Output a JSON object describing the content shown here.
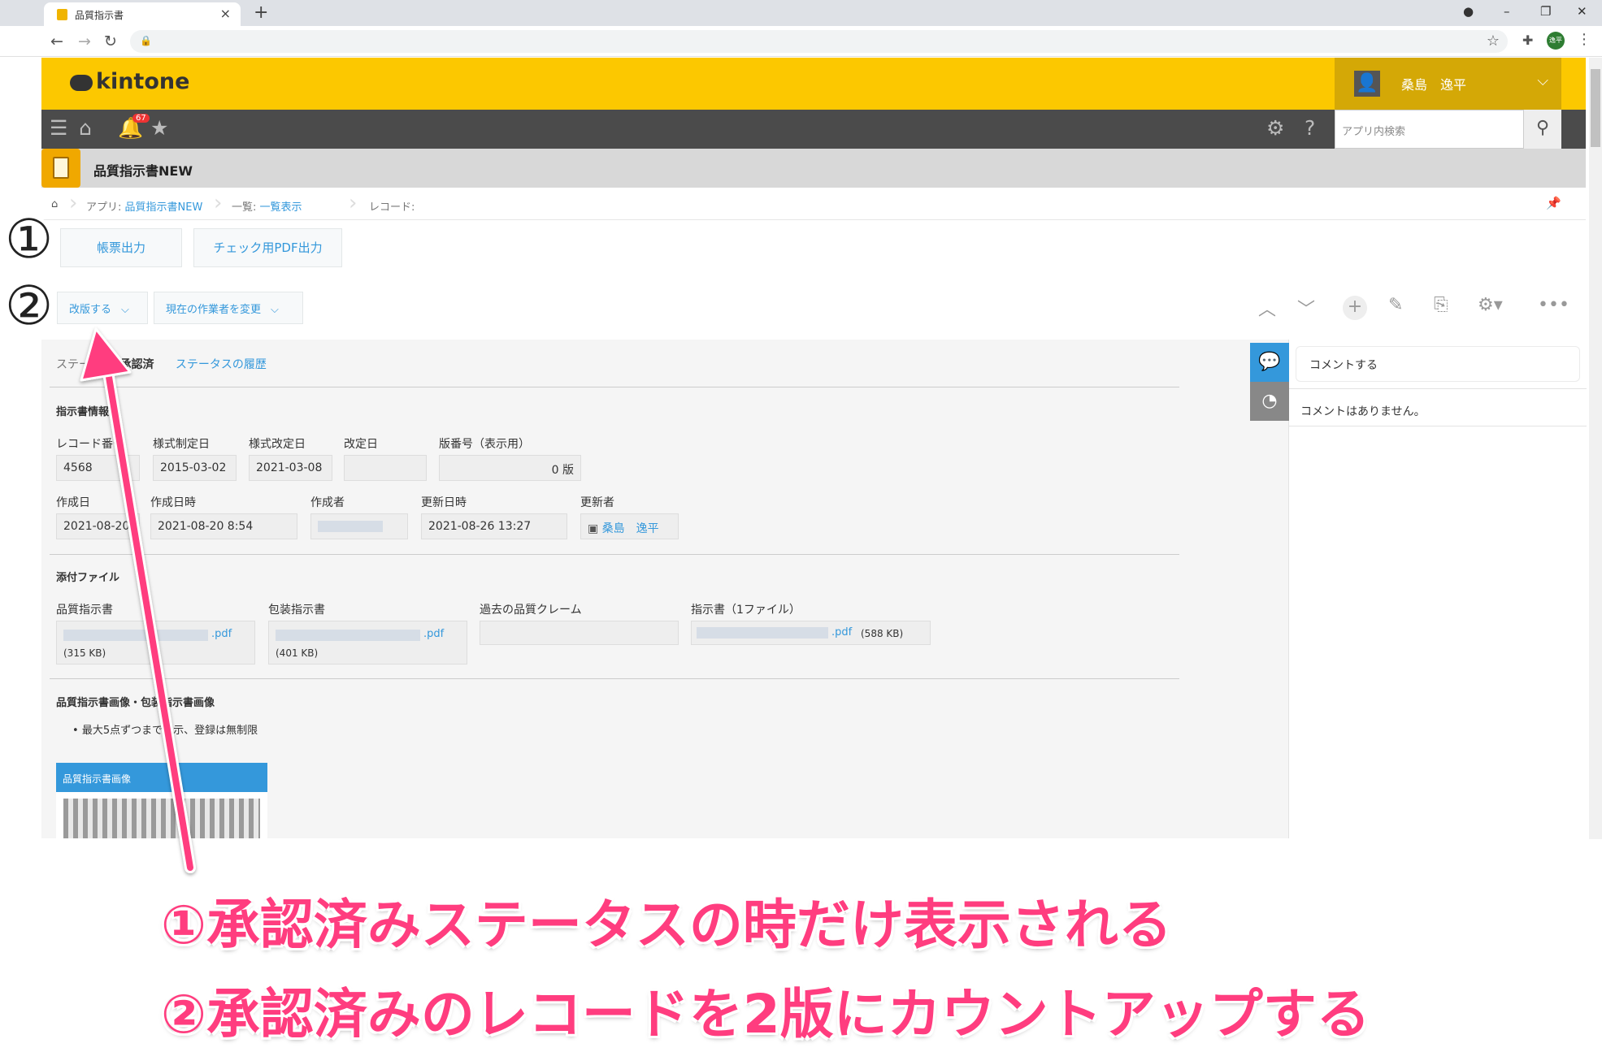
{
  "browser": {
    "tab_title": "品質指示書",
    "user_initials": "逸平"
  },
  "header": {
    "logo": "kintone",
    "user_name": "桑島　逸平",
    "notification_count": "67",
    "search_placeholder": "アプリ内検索"
  },
  "app": {
    "name": "品質指示書NEW"
  },
  "breadcrumb": {
    "app_prefix": "アプリ: ",
    "app_link": "品質指示書NEW",
    "view_prefix": "一覧: ",
    "view_link": "一覧表示",
    "record_label": "レコード:"
  },
  "actions": {
    "print_button": "帳票出力",
    "pdf_button": "チェック用PDF出力",
    "revise_dropdown": "改版する",
    "assignee_dropdown": "現在の作業者を変更"
  },
  "status": {
    "label": "ステータス",
    "value": "承認済",
    "history_link": "ステータスの履歴"
  },
  "sections": {
    "info": "指示書情報",
    "attachments": "添付ファイル",
    "images": "品質指示書画像・包装指示書画像"
  },
  "fields": {
    "record_no_label": "レコード番号",
    "record_no": "4568",
    "form_created_label": "様式制定日",
    "form_created": "2015-03-02",
    "form_revised_label": "様式改定日",
    "form_revised": "2021-03-08",
    "revised_label": "改定日",
    "revised": "",
    "version_label": "版番号（表示用）",
    "version": "0 版",
    "created_label": "作成日",
    "created": "2021-08-20",
    "created_time_label": "作成日時",
    "created_time": "2021-08-20 8:54",
    "creator_label": "作成者",
    "updated_time_label": "更新日時",
    "updated_time": "2021-08-26 13:27",
    "updater_label": "更新者",
    "updater": "桑島　逸平"
  },
  "files": {
    "quality_label": "品質指示書",
    "quality_ext": ".pdf",
    "quality_size": "(315 KB)",
    "packaging_label": "包装指示書",
    "packaging_ext": ".pdf",
    "packaging_size": "(401 KB)",
    "claims_label": "過去の品質クレーム",
    "instruction_label": "指示書（1ファイル）",
    "instruction_ext": ".pdf",
    "instruction_size": "(588 KB)"
  },
  "images_note": "最大5点ずつまで表示、登録は無制限",
  "image_card_title": "品質指示書画像",
  "comments": {
    "input_placeholder": "コメントする",
    "empty_text": "コメントはありません。"
  },
  "annotations": {
    "marker1": "①",
    "marker2": "②",
    "note1": "①承認済みステータスの時だけ表示される",
    "note2": "②承認済みのレコードを2版にカウントアップする"
  },
  "colors": {
    "brand_yellow": "#fcc800",
    "link_blue": "#3498db",
    "annotation_pink": "#ff3d7f"
  }
}
